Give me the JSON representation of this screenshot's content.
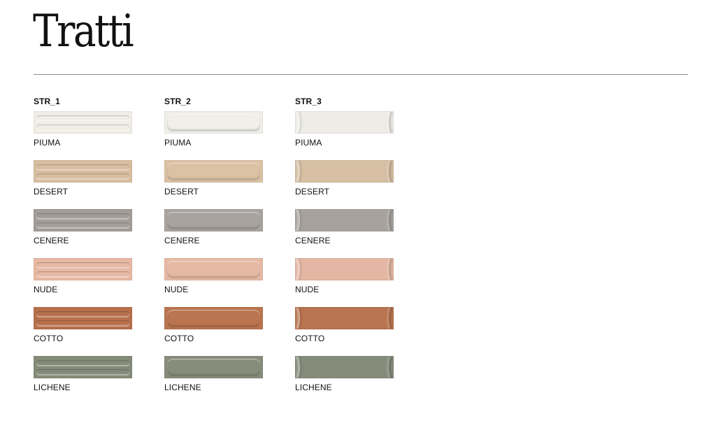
{
  "page": {
    "title": "Tratti"
  },
  "columns": [
    {
      "header": "STR_1",
      "style": "str1",
      "items": [
        {
          "label": "PIUMA",
          "color": "#f0eee6"
        },
        {
          "label": "DESERT",
          "color": "#d8bea0"
        },
        {
          "label": "CENERE",
          "color": "#a39d99"
        },
        {
          "label": "NUDE",
          "color": "#e7b8a3"
        },
        {
          "label": "COTTO",
          "color": "#b7704b"
        },
        {
          "label": "LICHENE",
          "color": "#848b78"
        }
      ]
    },
    {
      "header": "STR_2",
      "style": "str2",
      "items": [
        {
          "label": "PIUMA",
          "color": "#f1efe9"
        },
        {
          "label": "DESERT",
          "color": "#dbc2a4"
        },
        {
          "label": "CENERE",
          "color": "#a8a39f"
        },
        {
          "label": "NUDE",
          "color": "#e6b9a5"
        },
        {
          "label": "COTTO",
          "color": "#ba744f"
        },
        {
          "label": "LICHENE",
          "color": "#878d7b"
        }
      ]
    },
    {
      "header": "STR_3",
      "style": "str3",
      "items": [
        {
          "label": "PIUMA",
          "color": "#eeece6"
        },
        {
          "label": "DESERT",
          "color": "#d6bfa3"
        },
        {
          "label": "CENERE",
          "color": "#a7a29d"
        },
        {
          "label": "NUDE",
          "color": "#e3b7a3"
        },
        {
          "label": "COTTO",
          "color": "#b8734f"
        },
        {
          "label": "LICHENE",
          "color": "#858c7a"
        }
      ]
    }
  ]
}
